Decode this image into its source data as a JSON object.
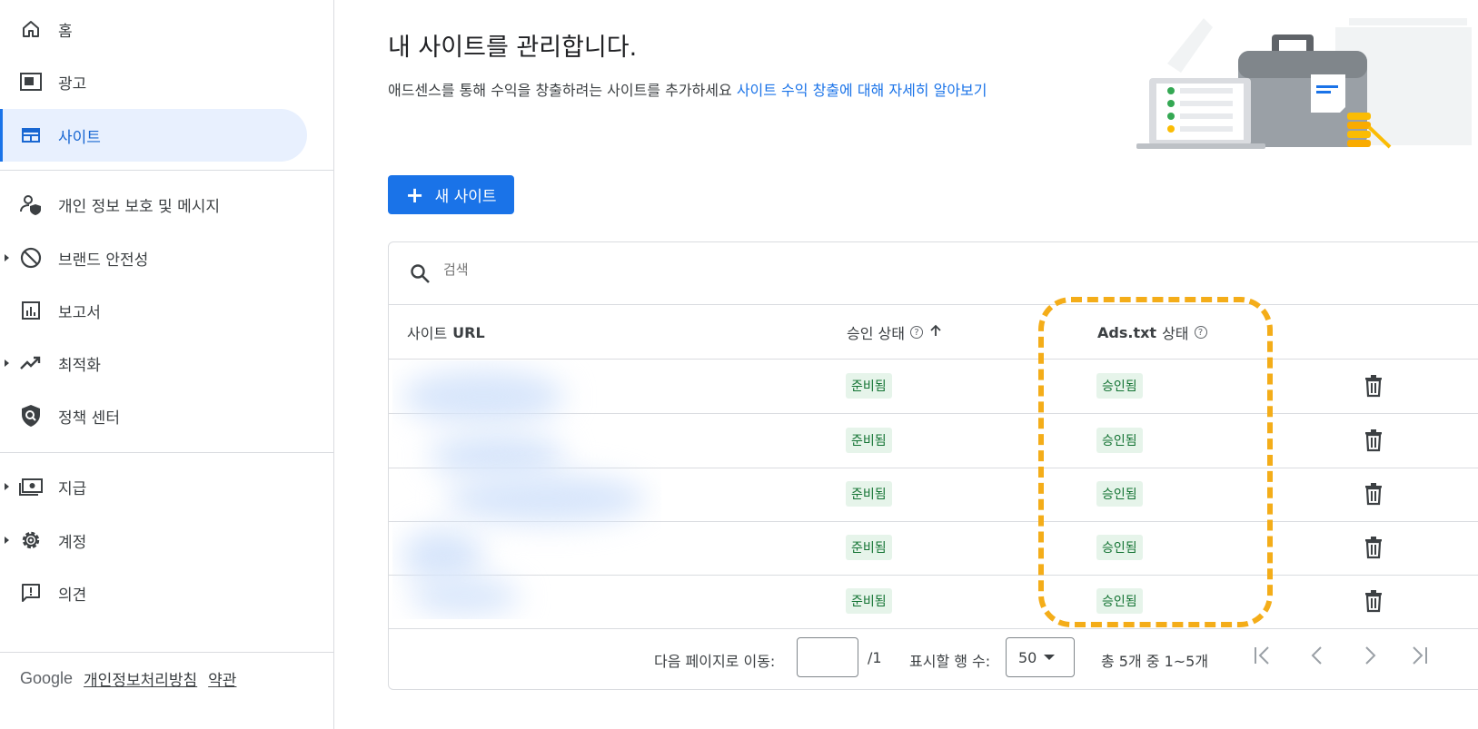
{
  "sidebar": {
    "items": [
      {
        "label": "홈",
        "icon": "home-icon"
      },
      {
        "label": "광고",
        "icon": "ads-icon"
      },
      {
        "label": "사이트",
        "icon": "sites-icon"
      },
      {
        "label": "개인 정보 보호 및 메시지",
        "icon": "privacy-icon"
      },
      {
        "label": "브랜드 안전성",
        "icon": "block-icon"
      },
      {
        "label": "보고서",
        "icon": "reports-icon"
      },
      {
        "label": "최적화",
        "icon": "trending-icon"
      },
      {
        "label": "정책 센터",
        "icon": "policy-icon"
      },
      {
        "label": "지급",
        "icon": "payments-icon"
      },
      {
        "label": "계정",
        "icon": "gear-icon"
      },
      {
        "label": "의견",
        "icon": "feedback-icon"
      }
    ],
    "active": "사이트",
    "footer": {
      "brand": "Google",
      "privacy": "개인정보처리방침",
      "terms": "약관"
    }
  },
  "main": {
    "title": "내 사이트를 관리합니다.",
    "subtitle": "애드센스를 통해 수익을 창출하려는 사이트를 추가하세요",
    "learn_more": "사이트 수익 창출에 대해 자세히 알아보기",
    "new_site_button": "새 사이트",
    "search_placeholder": "검색"
  },
  "table": {
    "columns": {
      "site_url_prefix": "사이트",
      "site_url_bold": "URL",
      "approval": "승인 상태",
      "ads_txt_bold": "Ads.txt",
      "ads_txt_suffix": "상태"
    },
    "rows": [
      {
        "approval": "준비됨",
        "ads_txt": "승인됨"
      },
      {
        "approval": "준비됨",
        "ads_txt": "승인됨"
      },
      {
        "approval": "준비됨",
        "ads_txt": "승인됨"
      },
      {
        "approval": "준비됨",
        "ads_txt": "승인됨"
      },
      {
        "approval": "준비됨",
        "ads_txt": "승인됨"
      }
    ]
  },
  "pagination": {
    "goto_label": "다음 페이지로 이동:",
    "goto_value": "",
    "total_pages": "/1",
    "rows_label": "표시할 행 수:",
    "rows_value": "50",
    "count_text": "총 5개 중 1~5개"
  },
  "colors": {
    "accent": "#1a73e8",
    "highlight": "#f4ad19",
    "chip_bg": "#e6f4ea",
    "chip_text": "#137333"
  }
}
